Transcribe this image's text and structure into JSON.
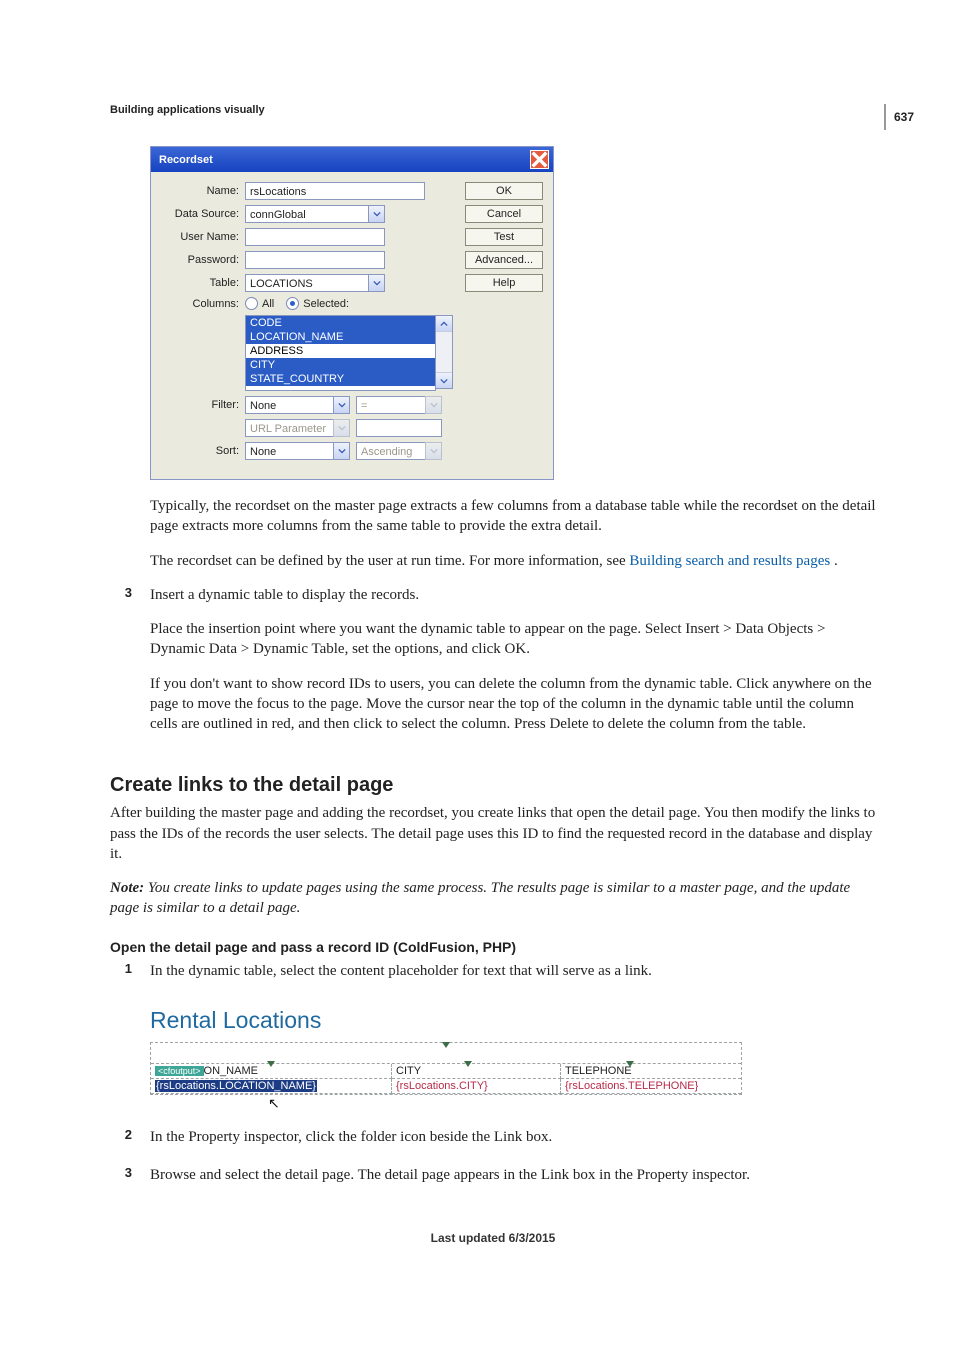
{
  "page_number": "637",
  "header": "Building applications visually",
  "dialog": {
    "title": "Recordset",
    "name_label": "Name:",
    "name_value": "rsLocations",
    "datasource_label": "Data Source:",
    "datasource_value": "connGlobal",
    "username_label": "User Name:",
    "username_value": "",
    "password_label": "Password:",
    "password_value": "",
    "table_label": "Table:",
    "table_value": "LOCATIONS",
    "columns_label": "Columns:",
    "columns_all": "All",
    "columns_selected": "Selected:",
    "columns_list": [
      "CODE",
      "LOCATION_NAME",
      "ADDRESS",
      "CITY",
      "STATE_COUNTRY"
    ],
    "filter_label": "Filter:",
    "filter_value": "None",
    "filter_op": "=",
    "filter_type": "URL Parameter",
    "sort_label": "Sort:",
    "sort_value": "None",
    "sort_dir": "Ascending",
    "buttons": {
      "ok": "OK",
      "cancel": "Cancel",
      "test": "Test",
      "advanced": "Advanced...",
      "help": "Help"
    }
  },
  "text": {
    "p_typically": "Typically, the recordset on the master page extracts a few columns from a database table while the recordset on the detail page extracts more columns from the same table to provide the extra detail.",
    "p_define_a": "The recordset can be defined by the user at run time. For more information, see ",
    "p_define_link": "Building search and results pages",
    "p_define_b": " .",
    "step3_num": "3",
    "step3_a": "Insert a dynamic table to display the records.",
    "step3_b": "Place the insertion point where you want the dynamic table to appear on the page. Select Insert > Data Objects > Dynamic Data > Dynamic Table, set the options, and click OK.",
    "step3_c": "If you don't want to show record IDs to users, you can delete the column from the dynamic table. Click anywhere on the page to move the focus to the page. Move the cursor near the top of the column in the dynamic table until the column cells are outlined in red, and then click to select the column. Press Delete to delete the column from the table.",
    "h2": "Create links to the detail page",
    "p_after": "After building the master page and adding the recordset, you create links that open the detail page. You then modify the links to pass the IDs of the records the user selects. The detail page uses this ID to find the requested record in the database and display it.",
    "note_label": "Note:",
    "note_text": " You create links to update pages using the same process. The results page is similar to a master page, and the update page is similar to a detail page.",
    "h3": "Open the detail page and pass a record ID (ColdFusion, PHP)",
    "step1_num": "1",
    "step1": "In the dynamic table, select the content placeholder for text that will serve as a link.",
    "step2_num": "2",
    "step2": "In the Property inspector, click the folder icon beside the Link box.",
    "step3b_num": "3",
    "step3b": "Browse and select the detail page. The detail page appears in the Link box in the Property inspector."
  },
  "rental": {
    "title": "Rental Locations",
    "headers": [
      "ON_NAME",
      "CITY",
      "TELEPHONE"
    ],
    "data": [
      "{rsLocations.LOCATION_NAME}",
      "{rsLocations.CITY}",
      "{rsLocations.TELEPHONE}"
    ]
  },
  "footer": "Last updated 6/3/2015"
}
